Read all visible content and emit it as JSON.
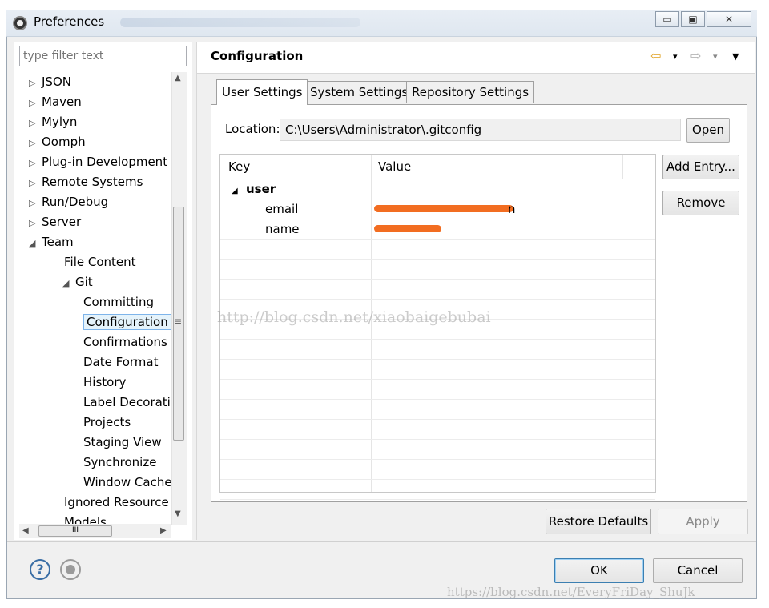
{
  "window": {
    "title": "Preferences",
    "buttons": {
      "minimize": "▭",
      "maximize": "▣",
      "close": "✕"
    }
  },
  "sidebar": {
    "filter_placeholder": "type filter text",
    "items": [
      {
        "label": "JSON",
        "arrow": "▷",
        "level": 0
      },
      {
        "label": "Maven",
        "arrow": "▷",
        "level": 0
      },
      {
        "label": "Mylyn",
        "arrow": "▷",
        "level": 0
      },
      {
        "label": "Oomph",
        "arrow": "▷",
        "level": 0
      },
      {
        "label": "Plug-in Development",
        "arrow": "▷",
        "level": 0
      },
      {
        "label": "Remote Systems",
        "arrow": "▷",
        "level": 0
      },
      {
        "label": "Run/Debug",
        "arrow": "▷",
        "level": 0
      },
      {
        "label": "Server",
        "arrow": "▷",
        "level": 0
      },
      {
        "label": "Team",
        "arrow": "◢",
        "level": 0
      },
      {
        "label": "File Content",
        "arrow": "",
        "level": 1
      },
      {
        "label": "Git",
        "arrow": "◢",
        "level": 1
      },
      {
        "label": "Committing",
        "arrow": "",
        "level": 2
      },
      {
        "label": "Configuration",
        "arrow": "",
        "level": 2
      },
      {
        "label": "Confirmations a",
        "arrow": "",
        "level": 2
      },
      {
        "label": "Date Format",
        "arrow": "",
        "level": 2
      },
      {
        "label": "History",
        "arrow": "",
        "level": 2
      },
      {
        "label": "Label Decoratio",
        "arrow": "",
        "level": 2
      },
      {
        "label": "Projects",
        "arrow": "",
        "level": 2
      },
      {
        "label": "Staging View",
        "arrow": "",
        "level": 2
      },
      {
        "label": "Synchronize",
        "arrow": "",
        "level": 2
      },
      {
        "label": "Window Cache",
        "arrow": "",
        "level": 2
      },
      {
        "label": "Ignored Resource",
        "arrow": "",
        "level": 1
      },
      {
        "label": "Models",
        "arrow": "",
        "level": 1
      }
    ],
    "selected_index": 12,
    "scroll_marker": "≡",
    "hscroll_grip": "III"
  },
  "main": {
    "title": "Configuration",
    "nav": {
      "back": "⇦",
      "back_menu": "▾",
      "forward": "⇨",
      "forward_menu": "▾",
      "view_menu": "▼"
    },
    "tabs": [
      {
        "label": "User Settings",
        "active": true
      },
      {
        "label": "System Settings",
        "active": false
      },
      {
        "label": "Repository Settings",
        "active": false
      }
    ],
    "location_label": "Location:",
    "location_value": "C:\\Users\\Administrator\\.gitconfig",
    "open_button": "Open",
    "table": {
      "columns": [
        "Key",
        "Value"
      ],
      "section": {
        "arrow": "◢",
        "label": "user"
      },
      "entries": [
        {
          "key": "email",
          "value_visible": "n"
        },
        {
          "key": "name",
          "value_visible": ""
        }
      ]
    },
    "add_entry_button": "Add Entry...",
    "remove_button": "Remove",
    "restore_defaults_button": "Restore Defaults",
    "apply_button": "Apply",
    "watermark": "http://blog.csdn.net/xiaobaigebubai"
  },
  "footer": {
    "help_icon_glyph": "?",
    "ok_button": "OK",
    "cancel_button": "Cancel",
    "watermark": "https://blog.csdn.net/EveryFriDay_ShuJk"
  },
  "colors": {
    "redaction": "#f26d21",
    "selection_bg": "#e5f3fb",
    "selection_border": "#7eb4ea"
  }
}
